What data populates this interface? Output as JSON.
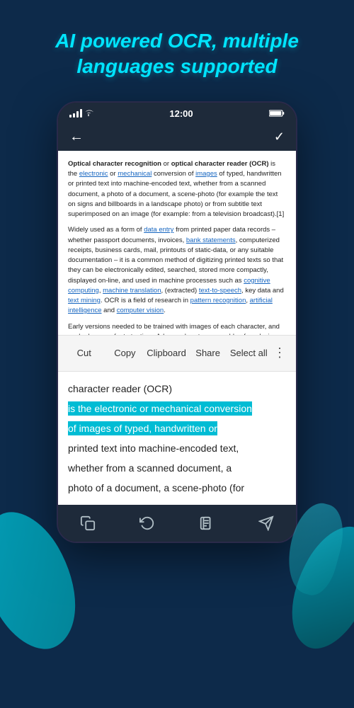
{
  "hero": {
    "title": "AI powered OCR, multiple languages supported"
  },
  "status_bar": {
    "time": "12:00",
    "signal": "signal",
    "wifi": "wifi",
    "battery": "battery"
  },
  "nav": {
    "back_icon": "←",
    "check_icon": "✓"
  },
  "ocr_text": {
    "paragraph1": "Optical character recognition or optical character reader (OCR) is the electronic or mechanical conversion of images of typed, handwritten or printed text into machine-encoded text, whether from a scanned document, a photo of a document, a scene-photo (for example the text on signs and billboards in a landscape photo) or from subtitle text superimposed on an image (for example: from a television broadcast).[1]",
    "paragraph2": "Widely used as a form of data entry from printed paper data records – whether passport documents, invoices, bank statements, computerized receipts, business cards, mail, printouts of static-data, or any suitable documentation – it is a common method of digitizing printed texts so that they can be electronically edited, searched, stored more compactly, displayed on-line, and used in machine processes such as cognitive computing, machine translation, (extracted) text-to-speech, key data and text mining. OCR is a field of research in pattern recognition, artificial intelligence and computer vision.",
    "paragraph3": "Early versions needed to be trained with images of each character, and worked on one font at a time. Advanced systems capable of producing a high degree of recognition accuracy for most fonts are now common, and with support for a variety of digital image file format inputs.[2] Some systems are capable of reproducing formatted output that closely approximates the original page including images, columns, and other non-textual components."
  },
  "context_menu": {
    "cut": "Cut",
    "copy": "Copy",
    "clipboard": "Clipboard",
    "share": "Share",
    "select_all": "Select all",
    "more_icon": "⋮"
  },
  "selected_text": {
    "line1": "character reader (OCR)",
    "line2_highlighted": "is the electronic or mechanical conversion",
    "line3_highlighted": "of images of typed, handwritten or",
    "line4": "printed text into machine-encoded text,",
    "line5": "whether from a scanned document, a",
    "line6": "photo of a document, a scene-photo (for"
  },
  "bottom_nav": {
    "icon1": "copy",
    "icon2": "undo",
    "icon3": "document",
    "icon4": "share"
  }
}
